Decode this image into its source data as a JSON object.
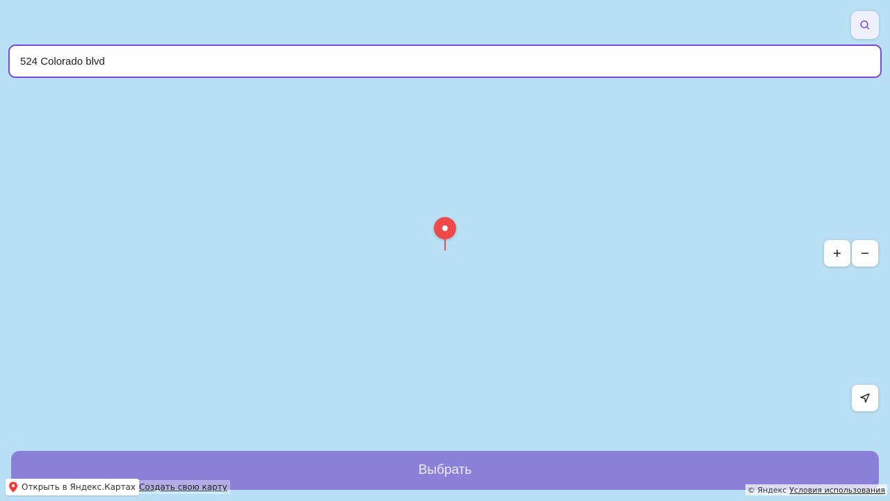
{
  "search": {
    "icon": "search-icon",
    "accent_color": "#7b47e3"
  },
  "address": {
    "value": "524 Colorado blvd",
    "placeholder": ""
  },
  "map": {
    "background_color": "#bae0f5",
    "pin_color": "#ef4848",
    "zoom_in_label": "+",
    "zoom_out_label": "−",
    "locate_icon": "navigation-arrow-icon"
  },
  "actions": {
    "select_label": "Выбрать",
    "select_color": "#8b80d8"
  },
  "footer": {
    "open_in_yandex_label": "Открыть в Яндекс.Картах",
    "create_map_label": "Создать свою карту",
    "copyright_label": "© Яндекс",
    "terms_label": "Условия использования"
  }
}
